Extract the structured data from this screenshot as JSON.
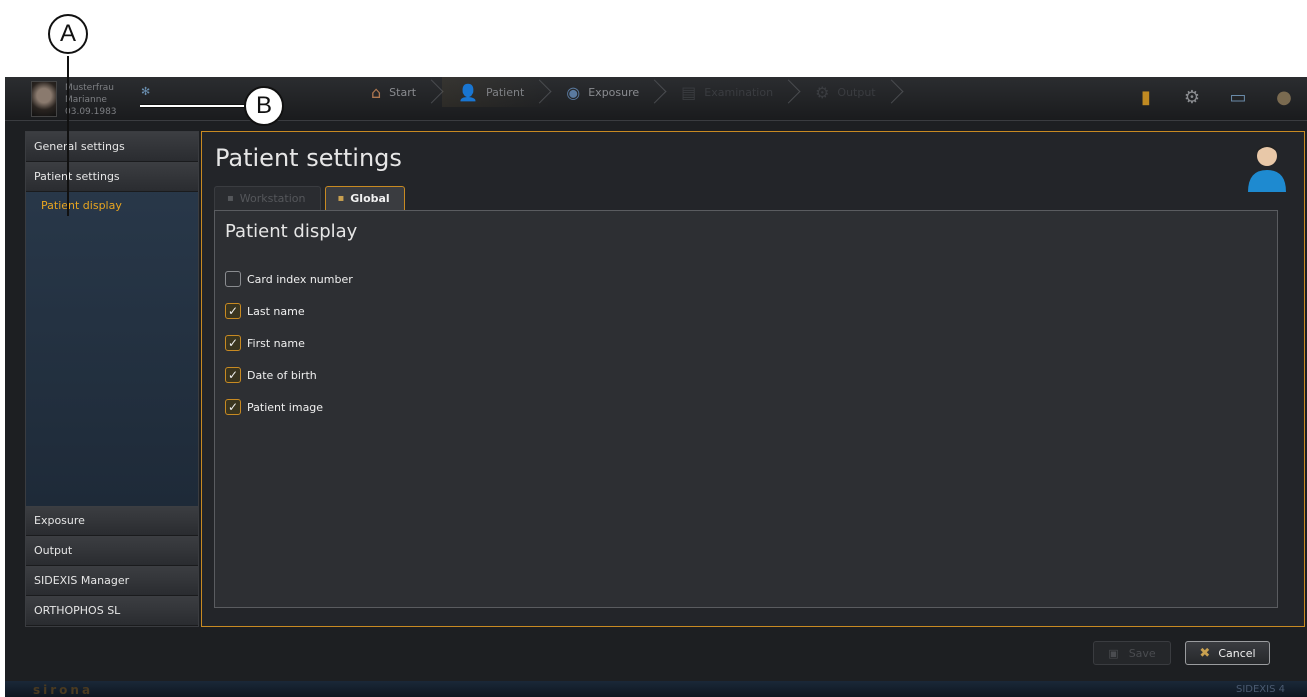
{
  "callouts": {
    "a": "A",
    "b": "B"
  },
  "patient": {
    "last_name": "Musterfrau",
    "first_name": "Marianne",
    "dob": "03.09.1983"
  },
  "workflow": [
    {
      "label": "Start",
      "icon": "house-icon",
      "state": "normal"
    },
    {
      "label": "Patient",
      "icon": "person-icon",
      "state": "active"
    },
    {
      "label": "Exposure",
      "icon": "disc-icon",
      "state": "normal"
    },
    {
      "label": "Examination",
      "icon": "document-icon",
      "state": "disabled"
    },
    {
      "label": "Output",
      "icon": "gear-icon",
      "state": "disabled"
    }
  ],
  "top_icons": [
    "book-icon",
    "settings-gear-icon",
    "monitor-icon",
    "help-icon"
  ],
  "sidebar": {
    "general_settings": "General settings",
    "patient_settings": "Patient settings",
    "patient_display": "Patient display",
    "exposure": "Exposure",
    "output": "Output",
    "sidexis_manager": "SIDEXIS Manager",
    "orthophos": "ORTHOPHOS SL"
  },
  "main": {
    "title": "Patient settings",
    "tabs": [
      {
        "label": "Workstation",
        "active": false
      },
      {
        "label": "Global",
        "active": true
      }
    ],
    "section_title": "Patient display",
    "options": [
      {
        "label": "Card index number",
        "checked": false
      },
      {
        "label": "Last name",
        "checked": true
      },
      {
        "label": "First name",
        "checked": true
      },
      {
        "label": "Date of birth",
        "checked": true
      },
      {
        "label": "Patient image",
        "checked": true
      }
    ]
  },
  "buttons": {
    "save": "Save",
    "cancel": "Cancel"
  },
  "footer": {
    "brand": "sirona",
    "product": "SIDEXIS 4"
  },
  "colors": {
    "accent": "#c88a22",
    "sidebar_sub": "#e8a520",
    "background": "#1d1f22"
  }
}
